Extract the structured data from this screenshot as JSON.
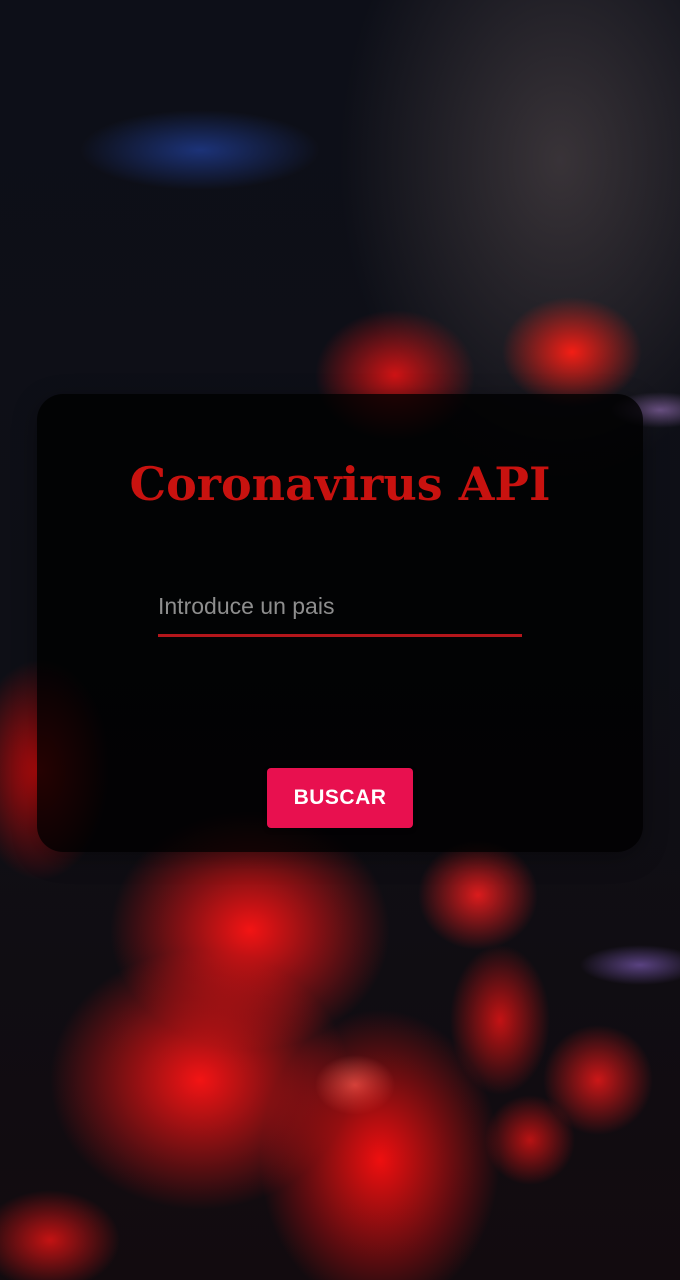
{
  "card": {
    "title": "Coronavirus API",
    "search": {
      "placeholder": "Introduce un pais",
      "value": ""
    },
    "button_label": "BUSCAR"
  },
  "colors": {
    "title": "#c8120f",
    "input_underline": "#b4161b",
    "button_background": "#e8104f",
    "button_text": "#ffffff"
  }
}
